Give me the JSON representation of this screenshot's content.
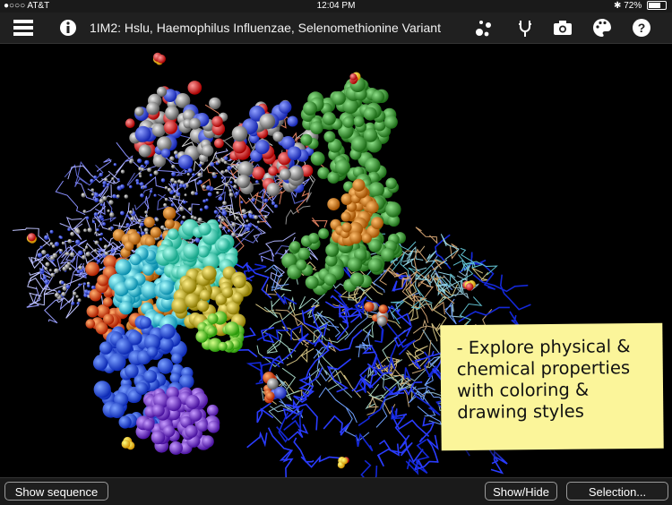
{
  "status": {
    "carrier": "●○○○ AT&T",
    "time": "12:04 PM",
    "battery": "72%",
    "battery_level": 0.72
  },
  "header": {
    "title": "1IM2: Hslu, Haemophilus Influenzae, Selenomethionine Variant"
  },
  "icons": {
    "menu": "menu-icon",
    "info": "info-icon",
    "molecule": "molecule-icon",
    "tool": "tuning-fork-icon",
    "camera": "camera-icon",
    "palette": "palette-icon",
    "help": "help-icon"
  },
  "note": {
    "text": "- Explore physical &\nchemical  properties\nwith coloring &\ndrawing styles"
  },
  "toolbar": {
    "show_sequence": "Show sequence",
    "show_hide": "Show/Hide",
    "selection": "Selection..."
  },
  "colors": {
    "note": "#fbf59a",
    "background": "#000000"
  }
}
